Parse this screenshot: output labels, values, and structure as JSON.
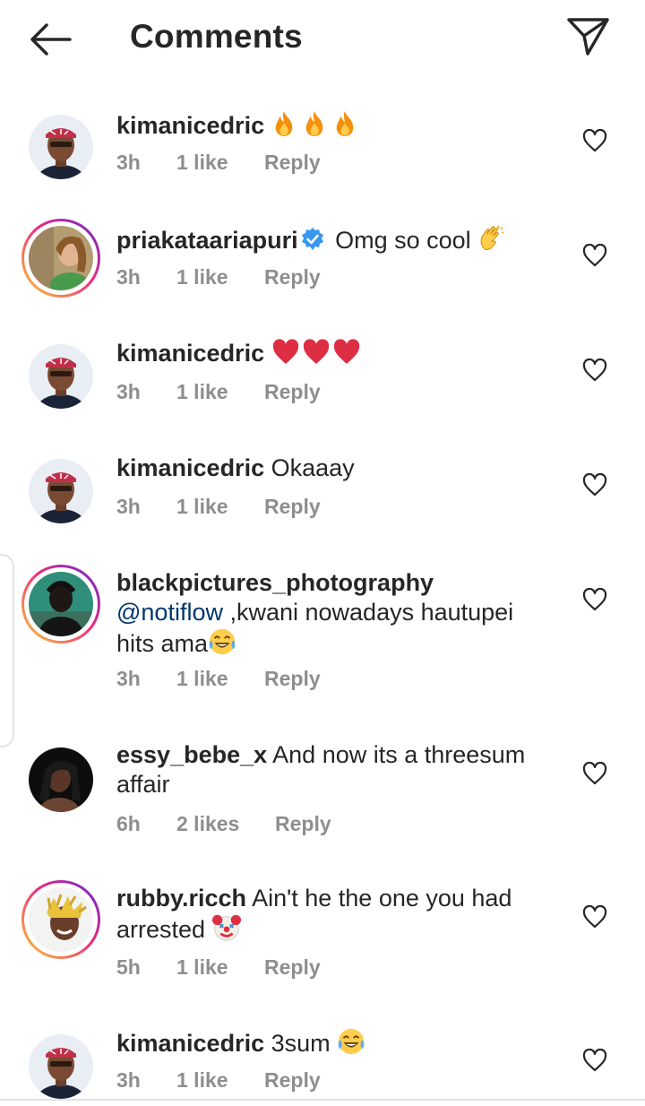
{
  "header": {
    "title": "Comments"
  },
  "colors": {
    "text": "#262626",
    "secondary": "#8e8e8e",
    "mention": "#00376b",
    "verified": "#3897f0",
    "story_ring": "#ee2a7b"
  },
  "comments": [
    {
      "username": "kimanicedric",
      "text": "",
      "time": "3h",
      "likes": "1 like",
      "reply": "Reply",
      "emoji": [
        "fire",
        "fire",
        "fire"
      ]
    },
    {
      "username": "priakataariapuri",
      "text": "Omg so cool ",
      "time": "3h",
      "likes": "1 like",
      "reply": "Reply",
      "verified": true,
      "emoji": [
        "clapping-hand"
      ]
    },
    {
      "username": "kimanicedric",
      "text": "",
      "time": "3h",
      "likes": "1 like",
      "reply": "Reply",
      "emoji": [
        "red-heart",
        "red-heart",
        "red-heart"
      ]
    },
    {
      "username": "kimanicedric",
      "text": "Okaaay",
      "time": "3h",
      "likes": "1 like",
      "reply": "Reply"
    },
    {
      "username": "blackpictures_photography",
      "mention": "@notiflow",
      "text": " ,kwani nowadays hautupei hits ama",
      "time": "3h",
      "likes": "1 like",
      "reply": "Reply",
      "emoji": [
        "laughing-tears"
      ]
    },
    {
      "username": "essy_bebe_x",
      "text": "And now its a threesum affair",
      "time": "6h",
      "likes": "2 likes",
      "reply": "Reply"
    },
    {
      "username": "rubby.ricch",
      "text": "Ain't he the one you had arrested ",
      "time": "5h",
      "likes": "1 like",
      "reply": "Reply",
      "emoji": [
        "clown-face"
      ]
    },
    {
      "username": "kimanicedric",
      "text": "3sum ",
      "time": "3h",
      "likes": "1 like",
      "reply": "Reply",
      "emoji": [
        "laughing-tears"
      ]
    }
  ]
}
